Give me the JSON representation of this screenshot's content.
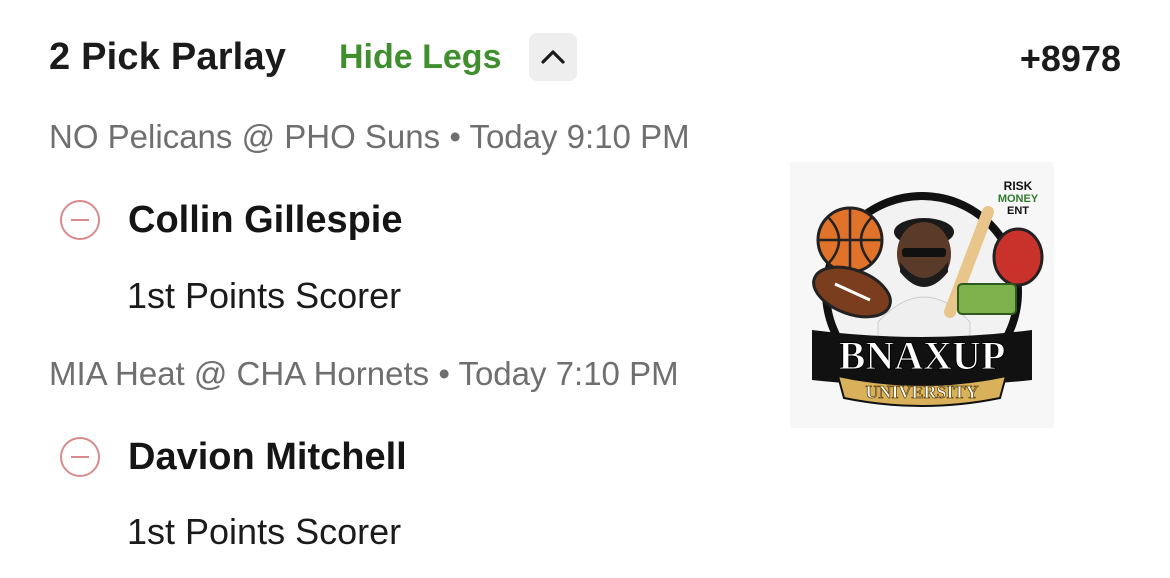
{
  "bet": {
    "title": "2 Pick Parlay",
    "toggle_label": "Hide Legs",
    "odds": "+8978"
  },
  "legs": [
    {
      "matchup": "NO Pelicans @ PHO Suns",
      "time": "Today 9:10 PM",
      "player": "Collin Gillespie",
      "market": "1st Points Scorer"
    },
    {
      "matchup": "MIA Heat @ CHA Hornets",
      "time": "Today 7:10 PM",
      "player": "Davion Mitchell",
      "market": "1st Points Scorer"
    }
  ],
  "logo": {
    "tag": "RISK MONEY ENT",
    "name": "BNAXUP",
    "subtitle": "UNIVERSITY"
  },
  "colors": {
    "accent_green": "#3f8f2f",
    "remove_red": "#d98b8b",
    "muted_text": "#6f6f6f"
  },
  "icons": [
    "chevron-up-icon",
    "minus-circle-icon"
  ]
}
